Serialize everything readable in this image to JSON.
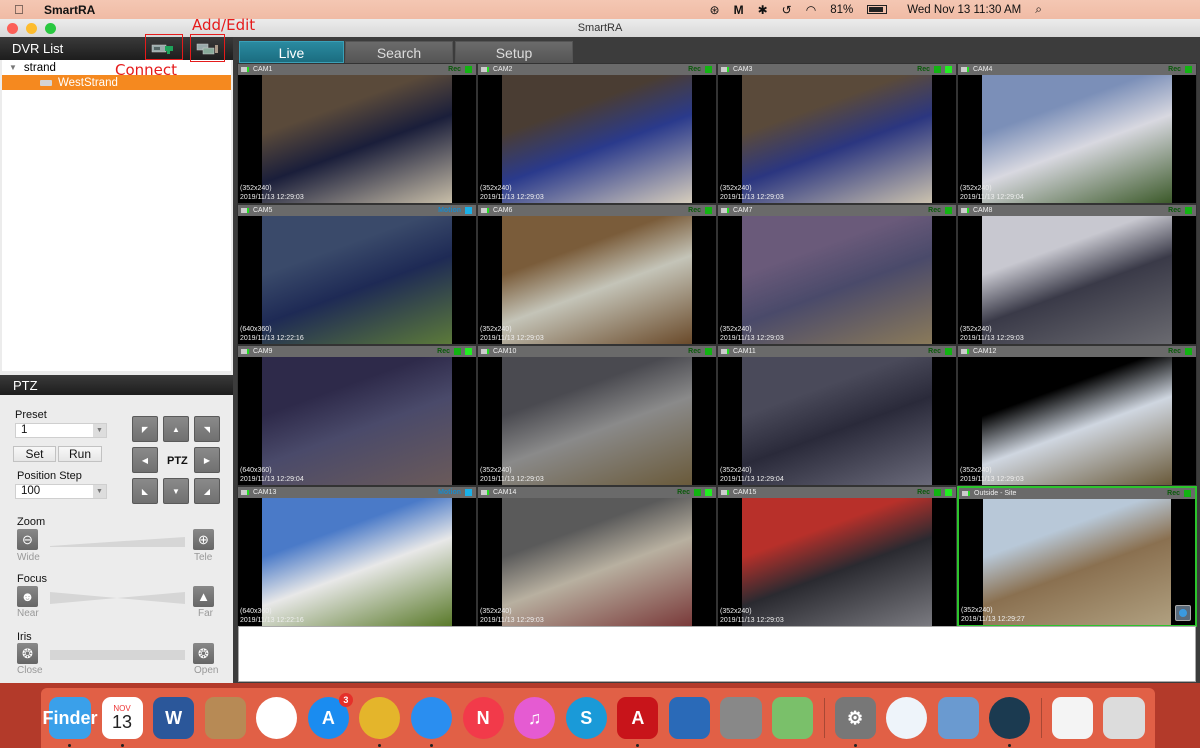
{
  "menubar": {
    "app_name": "SmartRA",
    "battery": "81%",
    "datetime": "Wed Nov 13  11:30 AM",
    "status_icons": [
      "creative-cloud-icon",
      "malwarebytes-icon",
      "bluetooth-icon",
      "time-machine-icon",
      "wifi-icon",
      "battery-icon"
    ]
  },
  "window": {
    "title": "SmartRA"
  },
  "dvr_list": {
    "title": "DVR List",
    "tree": [
      {
        "label": "strand",
        "expanded": true
      },
      {
        "label": "WestStrand",
        "selected": true
      }
    ]
  },
  "annotations": {
    "connect": "Connect",
    "add_edit": "Add/Edit",
    "color": "#e51b1b"
  },
  "ptz": {
    "title": "PTZ",
    "preset_label": "Preset",
    "preset_value": "1",
    "set_label": "Set",
    "run_label": "Run",
    "position_step_label": "Position Step",
    "position_step_value": "100",
    "center_label": "PTZ",
    "zoom_label": "Zoom",
    "zoom_min": "Wide",
    "zoom_max": "Tele",
    "focus_label": "Focus",
    "focus_min": "Near",
    "focus_max": "Far",
    "iris_label": "Iris",
    "iris_min": "Close",
    "iris_max": "Open"
  },
  "tabs": [
    {
      "label": "Live",
      "active": true
    },
    {
      "label": "Search",
      "active": false
    },
    {
      "label": "Setup",
      "active": false
    }
  ],
  "cameras": [
    {
      "name": "CAM1",
      "status": "Rec",
      "res": "(352x240)",
      "time": "2019/11/13 12:29:03",
      "extra": false,
      "colors": [
        "#5a4a3a",
        "#1a1e3a",
        "#c8bea8"
      ]
    },
    {
      "name": "CAM2",
      "status": "Rec",
      "res": "(352x240)",
      "time": "2019/11/13 12:29:03",
      "extra": false,
      "colors": [
        "#4a3d33",
        "#2a3a8c",
        "#d6cdbc"
      ]
    },
    {
      "name": "CAM3",
      "status": "Rec",
      "res": "(352x240)",
      "time": "2019/11/13 12:29:03",
      "extra": true,
      "colors": [
        "#5a4a3a",
        "#2b3680",
        "#cbc2ae"
      ]
    },
    {
      "name": "CAM4",
      "status": "Rec",
      "res": "(352x240)",
      "time": "2019/11/13 12:29:04",
      "extra": false,
      "colors": [
        "#7b8fb8",
        "#d8d8e0",
        "#3c5a2a"
      ]
    },
    {
      "name": "CAM5",
      "status": "Motion",
      "res": "(640x360)",
      "time": "2019/11/13 12:22:16",
      "extra": false,
      "colors": [
        "#3a4a6a",
        "#1e2a55",
        "#5c7a3a"
      ]
    },
    {
      "name": "CAM6",
      "status": "Rec",
      "res": "(352x240)",
      "time": "2019/11/13 12:29:03",
      "extra": false,
      "colors": [
        "#7a5c3a",
        "#c4c4b8",
        "#6a4a2a"
      ]
    },
    {
      "name": "CAM7",
      "status": "Rec",
      "res": "(352x240)",
      "time": "2019/11/13 12:29:03",
      "extra": false,
      "colors": [
        "#6a5a7a",
        "#4a4a6a",
        "#8a7a5a"
      ]
    },
    {
      "name": "CAM8",
      "status": "Rec",
      "res": "(352x240)",
      "time": "2019/11/13 12:29:03",
      "extra": false,
      "colors": [
        "#c8c8d0",
        "#3a3a48",
        "#6a6a70"
      ]
    },
    {
      "name": "CAM9",
      "status": "Rec",
      "res": "(640x360)",
      "time": "2019/11/13 12:29:04",
      "extra": true,
      "colors": [
        "#2e2a4a",
        "#4a4a6a",
        "#6a5a5a"
      ]
    },
    {
      "name": "CAM10",
      "status": "Rec",
      "res": "(352x240)",
      "time": "2019/11/13 12:29:03",
      "extra": false,
      "colors": [
        "#4a4a50",
        "#8a8a8a",
        "#6a5a3a"
      ]
    },
    {
      "name": "CAM11",
      "status": "Rec",
      "res": "(352x240)",
      "time": "2019/11/13 12:29:04",
      "extra": false,
      "colors": [
        "#4a4a5a",
        "#2a2a3a",
        "#6a6a7a"
      ]
    },
    {
      "name": "CAM12",
      "status": "Rec",
      "res": "(352x240)",
      "time": "2019/11/13 12:29:03",
      "extra": false,
      "colors": [
        "#000000",
        "#cfd6e0",
        "#6a5a3a"
      ]
    },
    {
      "name": "CAM13",
      "status": "Motion",
      "res": "(640x360)",
      "time": "2019/11/13 12:22:16",
      "extra": false,
      "colors": [
        "#4a7ac8",
        "#e8e8e8",
        "#5a7a2a"
      ]
    },
    {
      "name": "CAM14",
      "status": "Rec",
      "res": "(352x240)",
      "time": "2019/11/13 12:29:03",
      "extra": true,
      "colors": [
        "#5a5a5a",
        "#b8b0a0",
        "#7a3a3a"
      ]
    },
    {
      "name": "CAM15",
      "status": "Rec",
      "res": "(352x240)",
      "time": "2019/11/13 12:29:03",
      "extra": true,
      "colors": [
        "#b8302a",
        "#2a2a30",
        "#7a7a80"
      ]
    },
    {
      "name": "Outside - Site",
      "status": "Rec",
      "res": "(352x240)",
      "time": "2019/11/13 12:29:27",
      "extra": false,
      "colors": [
        "#b8c8d8",
        "#8a7050",
        "#b0a080"
      ],
      "focused": true
    }
  ],
  "status_colors": {
    "rec": "#12b312",
    "rec_bright": "#22ee22",
    "motion": "#1ab0e8"
  },
  "dock": [
    {
      "name": "finder",
      "label": "Finder",
      "color": "#3aa0ea",
      "running": true
    },
    {
      "name": "calendar",
      "label": "13",
      "top": "NOV",
      "color": "#ffffff",
      "running": true
    },
    {
      "name": "word",
      "label": "W",
      "color": "#2b579a",
      "running": false
    },
    {
      "name": "contacts",
      "label": "",
      "color": "#b78a55",
      "running": false
    },
    {
      "name": "photos",
      "label": "",
      "color": "#ffffff",
      "running": false
    },
    {
      "name": "app-store",
      "label": "A",
      "color": "#1a8cf0",
      "badge": "3",
      "running": false
    },
    {
      "name": "chrome",
      "label": "",
      "color": "#e4b52b",
      "running": true
    },
    {
      "name": "safari",
      "label": "",
      "color": "#2a8ef0",
      "running": true
    },
    {
      "name": "news",
      "label": "N",
      "color": "#f23a4a",
      "running": false
    },
    {
      "name": "itunes",
      "label": "♫",
      "color": "#e55bd2",
      "running": false
    },
    {
      "name": "skype",
      "label": "S",
      "color": "#1a9ad8",
      "running": false
    },
    {
      "name": "acrobat",
      "label": "A",
      "color": "#c8141a",
      "running": true
    },
    {
      "name": "kindle",
      "label": "",
      "color": "#2a6ab8",
      "running": false
    },
    {
      "name": "calculator",
      "label": "",
      "color": "#888888",
      "running": false
    },
    {
      "name": "maps",
      "label": "",
      "color": "#7ac06a",
      "running": false
    },
    {
      "name": "system-preferences",
      "label": "⚙",
      "color": "#777777",
      "running": true
    },
    {
      "name": "image-capture",
      "label": "",
      "color": "#eef4fa",
      "running": false
    },
    {
      "name": "preview",
      "label": "",
      "color": "#6a9ad0",
      "running": false
    },
    {
      "name": "smartra",
      "label": "",
      "color": "#1b3a50",
      "running": true
    },
    {
      "name": "safari-download",
      "label": "",
      "color": "#f4f4f4",
      "running": false
    },
    {
      "name": "trash",
      "label": "",
      "color": "#dcdcdc",
      "running": false
    }
  ]
}
